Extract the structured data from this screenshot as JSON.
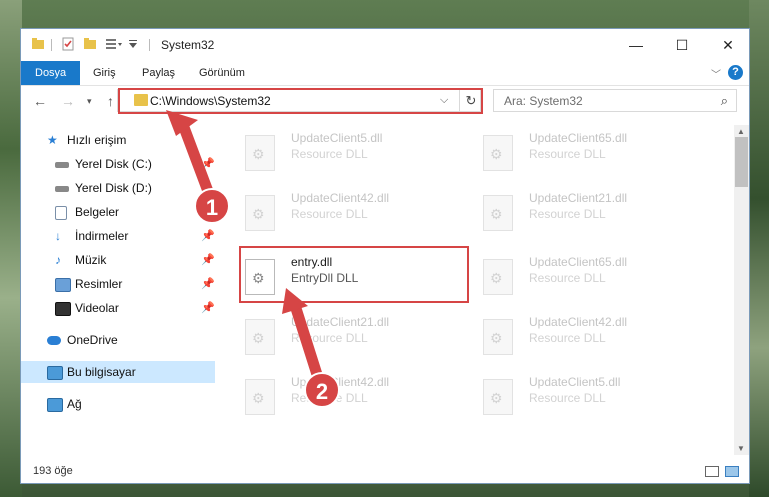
{
  "window": {
    "title": "System32",
    "controls": {
      "minimize": "—",
      "maximize": "☐",
      "close": "✕"
    }
  },
  "ribbon": {
    "tabs": [
      "Dosya",
      "Giriş",
      "Paylaş",
      "Görünüm"
    ],
    "help": "?"
  },
  "navbar": {
    "address": "C:\\Windows\\System32",
    "search_placeholder": "Ara: System32"
  },
  "sidebar": {
    "items": [
      {
        "label": "Hızlı erişim",
        "icon": "star-icon",
        "pinned": false
      },
      {
        "label": "Yerel Disk (C:)",
        "icon": "drive-icon",
        "pinned": true
      },
      {
        "label": "Yerel Disk (D:)",
        "icon": "drive-icon",
        "pinned": false
      },
      {
        "label": "Belgeler",
        "icon": "documents-icon",
        "pinned": true
      },
      {
        "label": "İndirmeler",
        "icon": "download-icon",
        "pinned": true
      },
      {
        "label": "Müzik",
        "icon": "music-icon",
        "pinned": true
      },
      {
        "label": "Resimler",
        "icon": "pictures-icon",
        "pinned": true
      },
      {
        "label": "Videolar",
        "icon": "videos-icon",
        "pinned": true
      },
      {
        "label": "OneDrive",
        "icon": "cloud-icon",
        "pinned": false
      },
      {
        "label": "Bu bilgisayar",
        "icon": "computer-icon",
        "pinned": false
      },
      {
        "label": "Ağ",
        "icon": "network-icon",
        "pinned": false
      }
    ]
  },
  "files": [
    {
      "name": "UpdateClient5.dll",
      "type": "Resource DLL"
    },
    {
      "name": "UpdateClient65.dll",
      "type": "Resource DLL"
    },
    {
      "name": "UpdateClient42.dll",
      "type": "Resource DLL"
    },
    {
      "name": "UpdateClient21.dll",
      "type": "Resource DLL"
    },
    {
      "name": "entry.dll",
      "type": "EntryDll DLL"
    },
    {
      "name": "UpdateClient65.dll",
      "type": "Resource DLL"
    },
    {
      "name": "UpdateClient21.dll",
      "type": "Resource DLL"
    },
    {
      "name": "UpdateClient42.dll",
      "type": "Resource DLL"
    },
    {
      "name": "UpdateClient42.dll",
      "type": "Resource DLL"
    },
    {
      "name": "UpdateClient5.dll",
      "type": "Resource DLL"
    }
  ],
  "status": {
    "count": "193 öğe"
  },
  "annotations": {
    "step1": "1",
    "step2": "2",
    "color": "#d64545"
  }
}
